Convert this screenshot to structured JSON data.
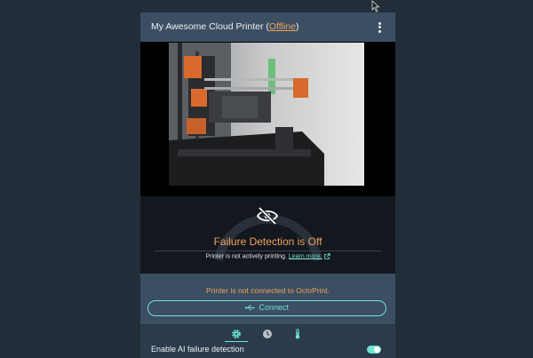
{
  "printer": {
    "name": "My Awesome Cloud Printer",
    "status_open": " (",
    "status": "Offline",
    "status_close": ")"
  },
  "failure": {
    "title": "Failure Detection is Off",
    "note": "Printer is not actively printing.",
    "learn_more": "Learn more."
  },
  "connection": {
    "message": "Printer is not connected to OctoPrint.",
    "connect_label": "Connect"
  },
  "tabs": [
    {
      "icon": "gear-icon",
      "active": true
    },
    {
      "icon": "clock-icon",
      "active": false
    },
    {
      "icon": "thermometer-icon",
      "active": false
    }
  ],
  "settings": {
    "ai_detection_label": "Enable AI failure detection",
    "ai_detection_enabled": true
  },
  "colors": {
    "accent": "#6fe5d2",
    "warning": "#f0a35c",
    "header": "#3b4e62"
  }
}
